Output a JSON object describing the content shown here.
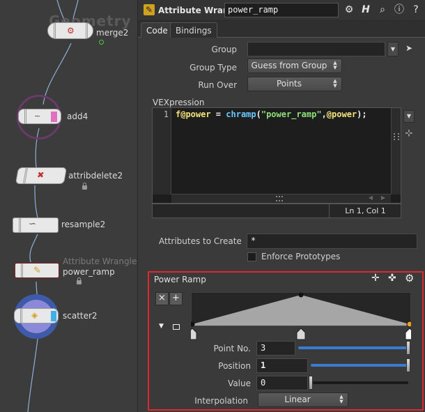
{
  "network": {
    "title": "Geometry",
    "nodes": [
      {
        "name": "merge2"
      },
      {
        "name": "add4"
      },
      {
        "name": "attribdelete2"
      },
      {
        "name": "resample2"
      },
      {
        "name": "power_ramp",
        "type": "Attribute Wrangle"
      },
      {
        "name": "scatter2"
      }
    ]
  },
  "header": {
    "node_type": "Attribute Wrangle",
    "node_name": "power_ramp",
    "icons": [
      "gear-icon",
      "houdini-help-icon",
      "search-icon",
      "info-icon",
      "help-icon"
    ]
  },
  "tabs": [
    {
      "label": "Code",
      "active": true
    },
    {
      "label": "Bindings",
      "active": false
    }
  ],
  "params": {
    "group_label": "Group",
    "group_value": "",
    "group_type_label": "Group Type",
    "group_type_value": "Guess from Group",
    "run_over_label": "Run Over",
    "run_over_value": "Points",
    "vex_label": "VEXpression",
    "code_line_number": "1",
    "code": {
      "var1": "f@power",
      "op": " = ",
      "fn": "chramp",
      "paren_open": "(",
      "str": "\"power_ramp\"",
      "comma": ",",
      "var2": "@power",
      "end": ");"
    },
    "status": "Ln 1, Col 1",
    "attrs_label": "Attributes to Create",
    "attrs_value": "*",
    "enforce_label": "Enforce Prototypes",
    "enforce_checked": false
  },
  "ramp": {
    "title": "Power Ramp",
    "add_label": "+",
    "remove_label": "×",
    "keys": [
      {
        "position": 0.0,
        "value": 0.0
      },
      {
        "position": 0.5,
        "value": 1.0
      },
      {
        "position": 1.0,
        "value": 0.0
      }
    ],
    "selected_key": 3,
    "point_no_label": "Point No.",
    "point_no_value": "3",
    "point_no_fraction": 1.0,
    "position_label": "Position",
    "position_value": "1",
    "position_fraction": 1.0,
    "value_label": "Value",
    "value_value": "0",
    "value_fraction": 0.0,
    "interp_label": "Interpolation",
    "interp_value": "Linear",
    "colors": {
      "fill": "#a6a6a6",
      "selected_key": "#f0a020",
      "wire": "#8fb0d8",
      "highlight": "#e3262d"
    }
  }
}
